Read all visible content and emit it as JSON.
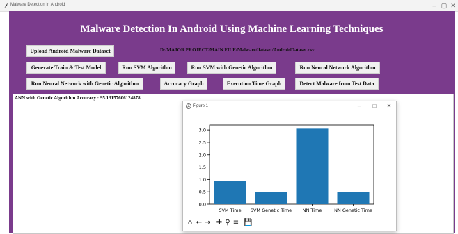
{
  "window": {
    "title": "Malware Detection In Android",
    "controls": [
      "–",
      "▢",
      "✕"
    ]
  },
  "main": {
    "heading": "Malware Detection In Android Using Machine Learning Techniques",
    "dataset_path": "D:/MAJOR PROJECT/MAIN FILE/Malware/dataset/AndroidDataset.csv",
    "buttons": {
      "upload": "Upload Android Malware Dataset",
      "train_test": "Generate Train & Test Model",
      "svm": "Run SVM Algorithm",
      "svm_ga": "Run SVM with Genetic Algorithm",
      "nn": "Run Neural Network Algorithm",
      "nn_ga": "Run Neural Network with Genetic Algorithm",
      "accuracy": "Accuracy Graph",
      "exec_time": "Execution Time Graph",
      "detect": "Detect Malware from Test Data"
    },
    "output_text": "ANN with Genetic Algorithm Accuracy : 95.13157606124878"
  },
  "figure": {
    "title": "Figure 1",
    "controls": [
      "–",
      "□",
      "✕"
    ],
    "toolbar": [
      "home-icon",
      "back-icon",
      "forward-icon",
      "pan-icon",
      "zoom-icon",
      "configure-icon",
      "save-icon"
    ]
  },
  "chart_data": {
    "type": "bar",
    "categories": [
      "SVM Time",
      "SVM Genetic Time",
      "NN Time",
      "NN Genetic Time"
    ],
    "values": [
      0.95,
      0.5,
      3.05,
      0.48
    ],
    "ylim": [
      0,
      3.2
    ],
    "yticks": [
      "0.0",
      "0.5",
      "1.0",
      "1.5",
      "2.0",
      "2.5",
      "3.0"
    ],
    "color": "#1f77b4",
    "grid": false
  }
}
